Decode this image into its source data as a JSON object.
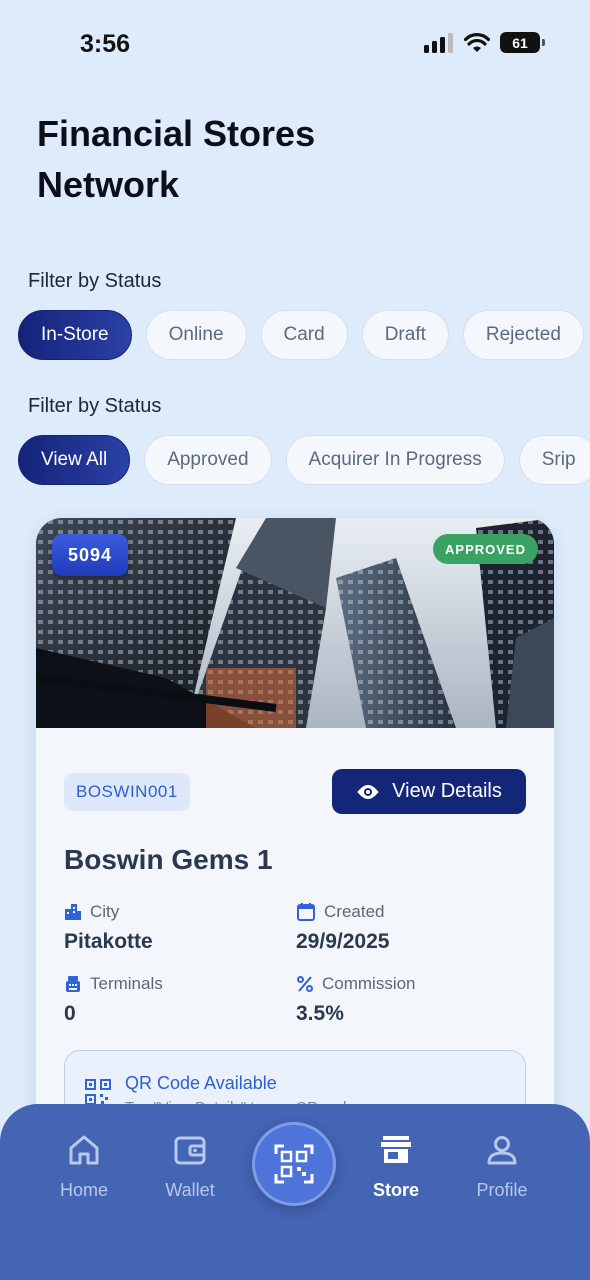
{
  "status_bar": {
    "time": "3:56",
    "battery": "61"
  },
  "page": {
    "title": "Financial Stores Network"
  },
  "filters": [
    {
      "label": "Filter by Status",
      "chips": [
        "In-Store",
        "Online",
        "Card",
        "Draft",
        "Rejected"
      ],
      "active": "In-Store"
    },
    {
      "label": "Filter by Status",
      "chips": [
        "View All",
        "Approved",
        "Acquirer In Progress",
        "Srip"
      ],
      "active": "View All"
    }
  ],
  "store": {
    "id": "5094",
    "status": "APPROVED",
    "code": "BOSWIN001",
    "view_details_label": "View Details",
    "name": "Boswin Gems 1",
    "city_label": "City",
    "city": "Pitakotte",
    "created_label": "Created",
    "created": "29/9/2025",
    "terminals_label": "Terminals",
    "terminals": "0",
    "commission_label": "Commission",
    "commission": "3.5%",
    "qr_title": "QR Code Available",
    "qr_subtitle": "Tap \"View Details\" to see QR code"
  },
  "nav": {
    "items": [
      {
        "label": "Home",
        "icon": "home-icon"
      },
      {
        "label": "Wallet",
        "icon": "wallet-icon"
      },
      {
        "label": "Store",
        "icon": "store-icon"
      },
      {
        "label": "Profile",
        "icon": "profile-icon"
      }
    ],
    "active": "Store"
  },
  "colors": {
    "background": "#deebfa",
    "primary": "#132677",
    "accent": "#2c5fcf",
    "approved": "#3aa262",
    "nav": "#4464b4"
  }
}
